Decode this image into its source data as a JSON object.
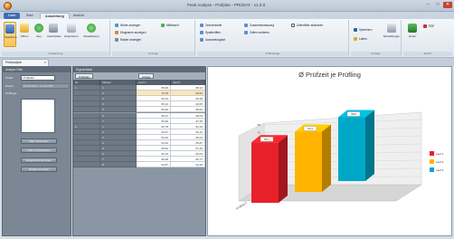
{
  "window": {
    "title": "Peak Analyse - Prüfplan - PRÜDAT - v1.0.0",
    "controls": [
      "–",
      "□",
      "✕"
    ]
  },
  "ribbon": {
    "tabs": [
      "Datei",
      "Start",
      "Auswertung",
      "Ansicht"
    ],
    "active_tab": "Auswertung",
    "groups": [
      {
        "label": "Auswertung",
        "buttons": [
          "Speichern",
          "Öffnen",
          "Neu",
          "Ausdrucken",
          "Exportieren",
          "Aktualisieren"
        ]
      },
      {
        "label": "Anzeige",
        "buttons": [
          "Werte anzeigen",
          "Diagramm anzeigen",
          "Raster anzeigen",
          "Mittelwert"
        ]
      },
      {
        "label": "Prüfvorlage",
        "buttons": [
          "Zeichenkette",
          "Zusammenfassung",
          "Zeilenfilter aktivieren",
          "Spaltenfilter",
          "Auswertungsart",
          "Zeilen sortieren"
        ]
      },
      {
        "label": "Vorlage",
        "buttons": [
          "Speichern",
          "Laden",
          "Einstellungen"
        ]
      },
      {
        "label": "Export",
        "buttons": [
          "Excel",
          "PDF"
        ]
      }
    ]
  },
  "document_tab": {
    "label": "Prüfanalyse",
    "close": "×"
  },
  "filter_panel": {
    "title": "Analyse Filter",
    "pruefer_label": "Prüfer:",
    "pruefer_value": "Prüfplatz",
    "datum_label": "Datum:",
    "datum_value": "01.01.2024 - 31.12.2024",
    "list_label": "Prüflinge:",
    "buttons": [
      "Filter anwenden",
      "Filter zurücksetzen",
      "Ergebnisse anzeigen",
      "Details anzeigen"
    ]
  },
  "grid": {
    "title": "Ergebnisliste",
    "group_chips": [
      "Prüfplatz",
      "Anlage"
    ],
    "columns": [
      "Nr.",
      "Messer",
      "Lauf 1",
      "Lauf 2"
    ],
    "groups": [
      {
        "label": "1",
        "rows": [
          [
            "1",
            "66,00",
            "68,12"
          ],
          [
            "2",
            "72,78",
            "69,54"
          ],
          [
            "3",
            "62,34",
            "66,38"
          ],
          [
            "4",
            "65,23",
            "62,05"
          ],
          [
            "5",
            "66,40",
            "68,64"
          ],
          [
            "6",
            "68,12",
            "69,03"
          ],
          [
            "7",
            "66,90",
            "67,45"
          ]
        ]
      },
      {
        "label": "2",
        "rows": [
          [
            "1",
            "62,78",
            "64,19"
          ],
          [
            "2",
            "64,97",
            "66,12"
          ],
          [
            "3",
            "63,92",
            "65,04"
          ],
          [
            "4",
            "64,93",
            "65,87"
          ],
          [
            "5",
            "66,52",
            "67,45"
          ],
          [
            "6",
            "65,10",
            "66,03"
          ],
          [
            "7",
            "66,48",
            "65,77"
          ],
          [
            "8",
            "63,87",
            "64,20"
          ]
        ]
      }
    ],
    "highlight_row": 1
  },
  "chart_data": {
    "type": "bar",
    "title": "Ø Prüfzeit je Prüfling",
    "categories": [
      "Prüfling"
    ],
    "series": [
      {
        "name": "Lauf 1",
        "values": [
          65.1
        ]
      },
      {
        "name": "Lauf 2",
        "values": [
          64.9
        ]
      },
      {
        "name": "Lauf 3",
        "values": [
          68.8
        ]
      }
    ],
    "data_labels": [
      "65,1",
      "64,9",
      "68,8"
    ],
    "xlabel": "Prüfling 1",
    "ylim": [
      0,
      80
    ],
    "y_ticks": [
      "0",
      "10",
      "20",
      "30",
      "40",
      "50",
      "60",
      "70",
      "80"
    ],
    "grid": true,
    "legend_position": "right",
    "colors": [
      "#e8202a",
      "#ffb400",
      "#00a8c8"
    ]
  }
}
